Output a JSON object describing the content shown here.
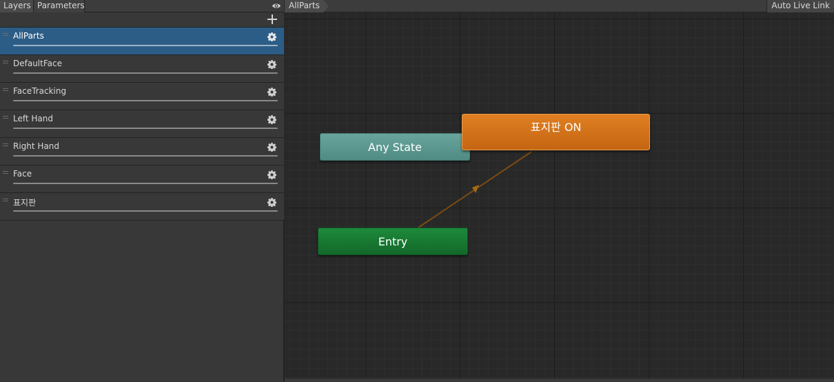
{
  "left_panel": {
    "tabs": {
      "layers": "Layers",
      "parameters": "Parameters"
    },
    "layers": [
      {
        "name": "AllParts",
        "selected": true
      },
      {
        "name": "DefaultFace",
        "selected": false
      },
      {
        "name": "FaceTracking",
        "selected": false
      },
      {
        "name": "Left Hand",
        "selected": false
      },
      {
        "name": "Right Hand",
        "selected": false
      },
      {
        "name": "Face",
        "selected": false
      },
      {
        "name": "표지판",
        "selected": false
      }
    ]
  },
  "graph": {
    "breadcrumb": "AllParts",
    "auto_live_link": "Auto Live Link",
    "nodes": {
      "any_state": "Any State",
      "entry": "Entry",
      "sign_on": "표지판 ON"
    }
  },
  "colors": {
    "selected_layer": "#2c5d87",
    "any_state": "#5f9a92",
    "entry": "#18782f",
    "default_state": "#d4731a",
    "transition": "#7a4d12"
  },
  "icons": {
    "visibility": "eye-icon",
    "add": "plus-icon",
    "settings": "gear-icon"
  }
}
